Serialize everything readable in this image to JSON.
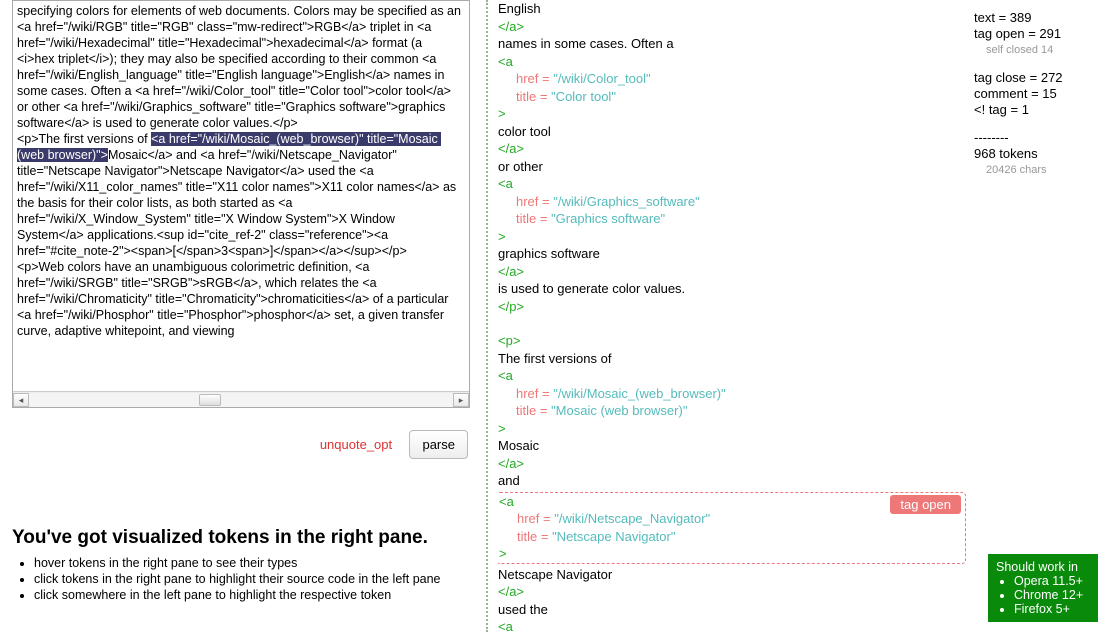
{
  "leftPane": {
    "source_before_sel": "specifying colors for elements of web documents. Colors may be specified as an <a href=\"/wiki/RGB\" title=\"RGB\" class=\"mw-redirect\">RGB</a> triplet in <a href=\"/wiki/Hexadecimal\" title=\"Hexadecimal\">hexadecimal</a> format (a <i>hex triplet</i>); they may also be specified according to their common <a href=\"/wiki/English_language\" title=\"English language\">English</a> names in some cases. Often a <a href=\"/wiki/Color_tool\" title=\"Color tool\">color tool</a> or other <a href=\"/wiki/Graphics_software\" title=\"Graphics software\">graphics software</a> is used to generate color values.</p>\n<p>The first versions of ",
    "source_sel": "<a href=\"/wiki/Mosaic_(web_browser)\" title=\"Mosaic (web browser)\">",
    "source_after_sel": "Mosaic</a> and <a href=\"/wiki/Netscape_Navigator\" title=\"Netscape Navigator\">Netscape Navigator</a> used the <a href=\"/wiki/X11_color_names\" title=\"X11 color names\">X11 color names</a> as the basis for their color lists, as both started as <a href=\"/wiki/X_Window_System\" title=\"X Window System\">X Window System</a> applications.<sup id=\"cite_ref-2\" class=\"reference\"><a href=\"#cite_note-2\"><span>[</span>3<span>]</span></a></sup></p>\n<p>Web colors have an unambiguous colorimetric definition, <a href=\"/wiki/SRGB\" title=\"SRGB\">sRGB</a>, which relates the <a href=\"/wiki/Chromaticity\" title=\"Chromaticity\">chromaticities</a> of a particular <a href=\"/wiki/Phosphor\" title=\"Phosphor\">phosphor</a> set, a given transfer curve, adaptive whitepoint, and viewing"
  },
  "controls": {
    "unquote": "unquote_opt",
    "parse": "parse"
  },
  "help": {
    "title": "You've got visualized tokens in the right pane.",
    "b1": "hover tokens in the right pane to see their types",
    "b2": "click tokens in the right pane to highlight their source code in the left pane",
    "b3": "click somewhere in the left pane to highlight the respective token"
  },
  "tokens": {
    "t1": "English",
    "t2": "</a>",
    "t3": " names in some cases. Often a ",
    "t4": "<a",
    "a4h": "href",
    "v4h": "\"/wiki/Color_tool\"",
    "a4t": "title",
    "v4t": "\"Color tool\"",
    "g4": ">",
    "t5": "color tool",
    "t6": "</a>",
    "t7": " or other ",
    "t8": "<a",
    "a8h": "href",
    "v8h": "\"/wiki/Graphics_software\"",
    "a8t": "title",
    "v8t": "\"Graphics software\"",
    "g8": ">",
    "t9": "graphics software",
    "t10": "</a>",
    "t11": " is used to generate color values.",
    "t12": "</p>",
    "t13": "<p>",
    "t14": "The first versions of ",
    "t15": "<a",
    "a15h": "href",
    "v15h": "\"/wiki/Mosaic_(web_browser)\"",
    "a15t": "title",
    "v15t": "\"Mosaic (web browser)\"",
    "g15": ">",
    "t16": "Mosaic",
    "t17": "</a>",
    "t18": " and ",
    "t19": "<a",
    "a19h": "href",
    "v19h": "\"/wiki/Netscape_Navigator\"",
    "a19t": "title",
    "v19t": "\"Netscape Navigator\"",
    "g19": ">",
    "t20": "Netscape Navigator",
    "t21": "</a>",
    "t22": " used the ",
    "t23": "<a",
    "tok_label": "tag open",
    "eq": " = "
  },
  "stats": {
    "l1": "text = 389",
    "l2": "tag open = 291",
    "l2s": "self closed 14",
    "l3": "tag close = 272",
    "l4": "comment = 15",
    "l5": "<! tag = 1",
    "sep": "--------",
    "l6": "968 tokens",
    "l6s": "20426 chars"
  },
  "compat": {
    "h": "Should work in",
    "b1": "Opera 11.5+",
    "b2": "Chrome 12+",
    "b3": "Firefox 5+"
  }
}
